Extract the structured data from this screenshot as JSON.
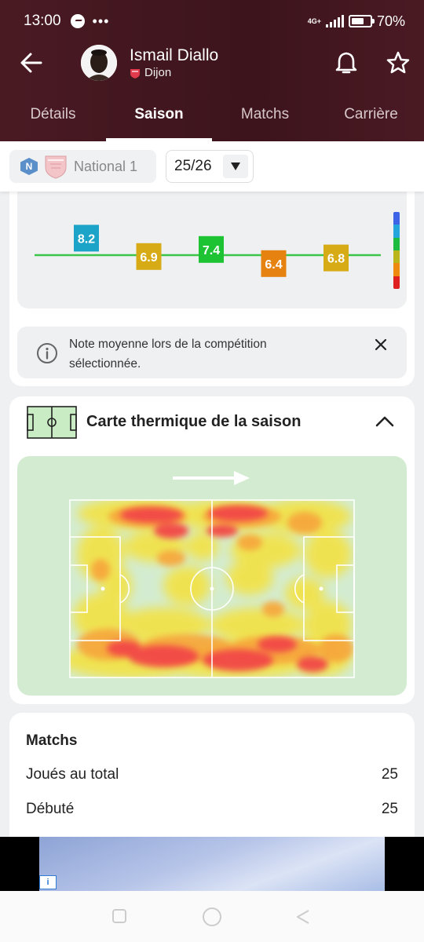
{
  "status_bar": {
    "time": "13:00",
    "dots": "•••",
    "network": "4G+",
    "battery_percent": 70,
    "battery_label": "70%"
  },
  "header": {
    "player_name": "Ismail Diallo",
    "club": "Dijon",
    "back_icon": "arrow-left-icon",
    "bell_icon": "bell-icon",
    "star_icon": "star-outline-icon"
  },
  "tabs": [
    {
      "label": "Détails",
      "active": false
    },
    {
      "label": "Saison",
      "active": true
    },
    {
      "label": "Matchs",
      "active": false
    },
    {
      "label": "Carrière",
      "active": false
    }
  ],
  "filter": {
    "competition_badge": "N",
    "competition": "National 1",
    "season": "25/26"
  },
  "ratings": {
    "values": [
      8.2,
      6.9,
      7.4,
      6.4,
      6.8
    ],
    "labels": [
      "8.2",
      "6.9",
      "7.4",
      "6.4",
      "6.8"
    ],
    "colors": [
      "#1ba4c8",
      "#d6ab16",
      "#1ec334",
      "#e6820f",
      "#d6ab16"
    ],
    "line_color": "#3dc44a",
    "scale_colors": [
      "#3d63e6",
      "#24a6dc",
      "#1dbb3f",
      "#b9b51b",
      "#ef8a10",
      "#e02020"
    ]
  },
  "info": {
    "text": "Note moyenne lors de la compétition sélectionnée.",
    "icon": "info-icon",
    "close_icon": "close-icon"
  },
  "heatmap": {
    "title": "Carte thermique de la saison",
    "toggle_icon": "chevron-up-icon",
    "direction_icon": "arrow-right-icon",
    "colors": {
      "pitch": "#d3ecd1",
      "low": "#f5e13a",
      "mid": "#f7a53a",
      "high": "#f24646"
    }
  },
  "matches": {
    "title": "Matchs",
    "rows": [
      {
        "label": "Joués au total",
        "value": "25"
      },
      {
        "label": "Débuté",
        "value": "25"
      }
    ]
  },
  "ad": {
    "badge": "i"
  }
}
